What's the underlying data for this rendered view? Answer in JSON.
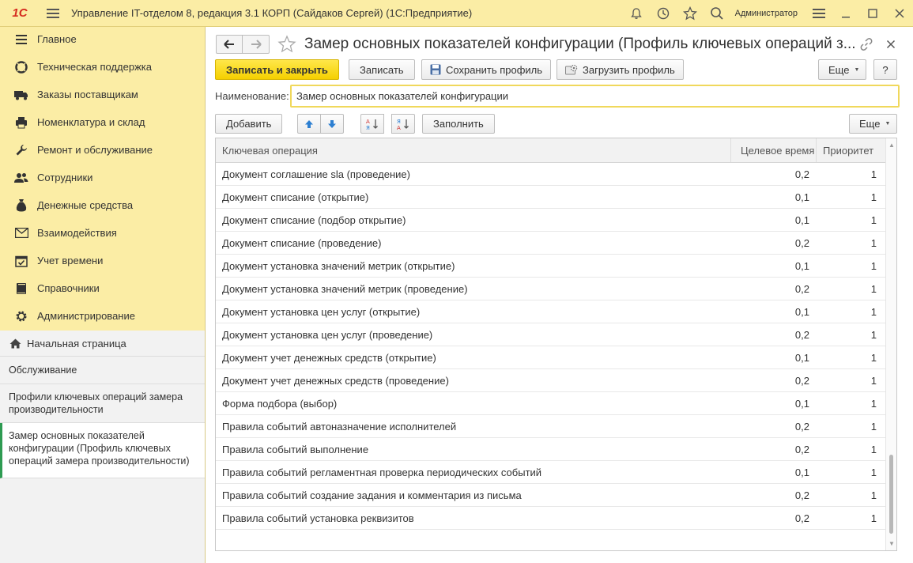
{
  "app": {
    "logo": "1С",
    "title": "Управление IT-отделом 8, редакция 3.1 КОРП (Сайдаков Сергей)  (1С:Предприятие)",
    "user": "Администратор"
  },
  "sidebar": {
    "items": [
      {
        "label": "Главное",
        "icon": "menu-icon"
      },
      {
        "label": "Техническая поддержка",
        "icon": "support-icon"
      },
      {
        "label": "Заказы поставщикам",
        "icon": "truck-icon"
      },
      {
        "label": "Номенклатура и склад",
        "icon": "printer-icon"
      },
      {
        "label": "Ремонт и обслуживание",
        "icon": "wrench-icon"
      },
      {
        "label": "Сотрудники",
        "icon": "people-icon"
      },
      {
        "label": "Денежные средства",
        "icon": "money-bag-icon"
      },
      {
        "label": "Взаимодействия",
        "icon": "envelope-icon"
      },
      {
        "label": "Учет времени",
        "icon": "calendar-icon"
      },
      {
        "label": "Справочники",
        "icon": "book-icon"
      },
      {
        "label": "Администрирование",
        "icon": "gear-icon"
      }
    ],
    "recent": {
      "home": "Начальная страница",
      "items": [
        "Обслуживание",
        "Профили ключевых операций замера производительности",
        "Замер основных показателей конфигурации (Профиль ключевых операций замера производительности)"
      ]
    }
  },
  "form": {
    "title": "Замер основных показателей конфигурации (Профиль ключевых операций з...",
    "toolbar": {
      "save_close": "Записать и закрыть",
      "save": "Записать",
      "save_profile": "Сохранить профиль",
      "load_profile": "Загрузить профиль",
      "more": "Еще",
      "help": "?"
    },
    "name_label": "Наименование:",
    "name_value": "Замер основных показателей конфигурации",
    "table_toolbar": {
      "add": "Добавить",
      "fill": "Заполнить",
      "more": "Еще"
    },
    "table": {
      "columns": [
        "Ключевая операция",
        "Целевое время",
        "Приоритет"
      ],
      "rows": [
        [
          "Документ соглашение sla (проведение)",
          "0,2",
          "1"
        ],
        [
          "Документ списание (открытие)",
          "0,1",
          "1"
        ],
        [
          "Документ списание (подбор открытие)",
          "0,1",
          "1"
        ],
        [
          "Документ списание (проведение)",
          "0,2",
          "1"
        ],
        [
          "Документ установка значений метрик (открытие)",
          "0,1",
          "1"
        ],
        [
          "Документ установка значений метрик (проведение)",
          "0,2",
          "1"
        ],
        [
          "Документ установка цен услуг (открытие)",
          "0,1",
          "1"
        ],
        [
          "Документ установка цен услуг (проведение)",
          "0,2",
          "1"
        ],
        [
          "Документ учет денежных средств (открытие)",
          "0,1",
          "1"
        ],
        [
          "Документ учет денежных средств (проведение)",
          "0,2",
          "1"
        ],
        [
          "Форма подбора (выбор)",
          "0,1",
          "1"
        ],
        [
          "Правила событий автоназначение исполнителей",
          "0,2",
          "1"
        ],
        [
          "Правила событий выполнение",
          "0,2",
          "1"
        ],
        [
          "Правила событий регламентная проверка периодических событий",
          "0,1",
          "1"
        ],
        [
          "Правила событий создание задания и комментария из письма",
          "0,2",
          "1"
        ],
        [
          "Правила событий установка реквизитов",
          "0,2",
          "1"
        ]
      ]
    }
  }
}
